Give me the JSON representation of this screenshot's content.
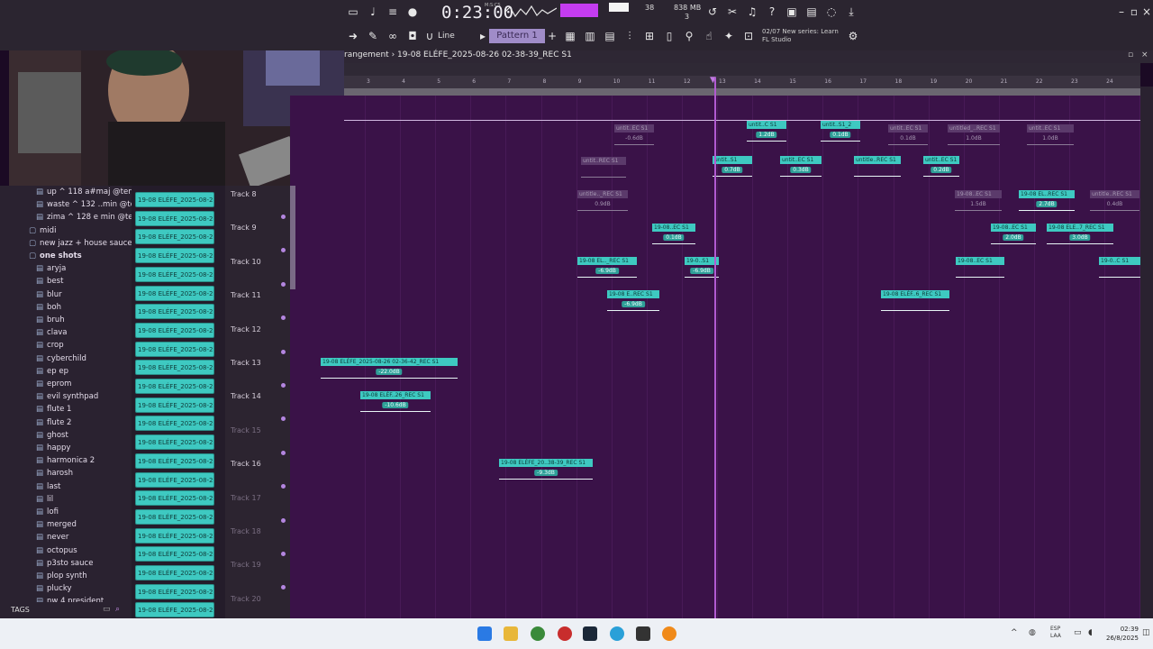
{
  "toolbar": {
    "time": "0:23:00",
    "time_label": "M:S:CS",
    "cpu": "38",
    "memory": "838 MB",
    "polyphony": "3",
    "snap": "Line",
    "pattern": "Pattern 1",
    "news_line1": "02/07  New series: Learn",
    "news_line2": "FL Studio"
  },
  "playlist": {
    "title": "rangement  ›  19-08 ELÉFE_2025-08-26 02-38-39_REC S1",
    "ruler_ticks": [
      "3",
      "4",
      "5",
      "6",
      "7",
      "8",
      "9",
      "10",
      "11",
      "12",
      "13",
      "14",
      "15",
      "16",
      "17",
      "18",
      "19",
      "20",
      "21",
      "22",
      "23",
      "24"
    ]
  },
  "browser": {
    "items": [
      {
        "label": "up ^ 118 a#maj @tengo",
        "type": "file"
      },
      {
        "label": "waste ^ 132 ..min @tengo",
        "type": "file"
      },
      {
        "label": "zima ^ 128 e min @tengo",
        "type": "file"
      },
      {
        "label": "midi",
        "type": "folder"
      },
      {
        "label": "new jazz + house sauce",
        "type": "folder"
      },
      {
        "label": "one shots",
        "type": "folder-open"
      },
      {
        "label": "aryja",
        "type": "file"
      },
      {
        "label": "best",
        "type": "file"
      },
      {
        "label": "blur",
        "type": "file"
      },
      {
        "label": "boh",
        "type": "file"
      },
      {
        "label": "bruh",
        "type": "file"
      },
      {
        "label": "clava",
        "type": "file"
      },
      {
        "label": "crop",
        "type": "file"
      },
      {
        "label": "cyberchild",
        "type": "file"
      },
      {
        "label": "ep ep",
        "type": "file"
      },
      {
        "label": "eprom",
        "type": "file"
      },
      {
        "label": "evil synthpad",
        "type": "file"
      },
      {
        "label": "flute 1",
        "type": "file"
      },
      {
        "label": "flute 2",
        "type": "file"
      },
      {
        "label": "ghost",
        "type": "file"
      },
      {
        "label": "happy",
        "type": "file"
      },
      {
        "label": "harmonica 2",
        "type": "file"
      },
      {
        "label": "harosh",
        "type": "file"
      },
      {
        "label": "last",
        "type": "file"
      },
      {
        "label": "lil",
        "type": "file"
      },
      {
        "label": "lofi",
        "type": "file"
      },
      {
        "label": "merged",
        "type": "file"
      },
      {
        "label": "never",
        "type": "file"
      },
      {
        "label": "octopus",
        "type": "file"
      },
      {
        "label": "p3sto sauce",
        "type": "file"
      },
      {
        "label": "plop synth",
        "type": "file"
      },
      {
        "label": "plucky",
        "type": "file"
      },
      {
        "label": "nw 4 president",
        "type": "file"
      }
    ],
    "tags_label": "TAGS"
  },
  "channels": {
    "label": "19-08 ELÉFE_2025-08-2..",
    "count": 23
  },
  "tracks": [
    {
      "label": "Track 8",
      "dim": false
    },
    {
      "label": "Track 9",
      "dim": false
    },
    {
      "label": "Track 10",
      "dim": false
    },
    {
      "label": "Track 11",
      "dim": false
    },
    {
      "label": "Track 12",
      "dim": false
    },
    {
      "label": "Track 13",
      "dim": false
    },
    {
      "label": "Track 14",
      "dim": false
    },
    {
      "label": "Track 15",
      "dim": true
    },
    {
      "label": "Track 16",
      "dim": false
    },
    {
      "label": "Track 17",
      "dim": true
    },
    {
      "label": "Track 18",
      "dim": true
    },
    {
      "label": "Track 19",
      "dim": true
    },
    {
      "label": "Track 20",
      "dim": true
    }
  ],
  "clips": [
    {
      "name": "untit..EC S1",
      "db": "-0.6dB",
      "dim": true
    },
    {
      "name": "untit..C S1",
      "db": "1.2dB",
      "dim": false
    },
    {
      "name": "untit..S1_2",
      "db": "0.1dB",
      "dim": false
    },
    {
      "name": "untit..EC S1",
      "db": "0.1dB",
      "dim": true
    },
    {
      "name": "untitled_..REC S1",
      "db": "1.0dB",
      "dim": true
    },
    {
      "name": "untit..EC S1",
      "db": "1.0dB",
      "dim": true
    },
    {
      "name": "untit..REC S1",
      "db": "",
      "dim": true
    },
    {
      "name": "untit..S1",
      "db": "0.7dB",
      "dim": false
    },
    {
      "name": "untit..EC S1",
      "db": "0.3dB",
      "dim": false
    },
    {
      "name": "untitle..REC S1",
      "db": "",
      "dim": false
    },
    {
      "name": "untit..EC S1",
      "db": "0.2dB",
      "dim": false
    },
    {
      "name": "untitle.._REC S1",
      "db": "0.9dB",
      "dim": true
    },
    {
      "name": "19-08..EC S1",
      "db": "1.5dB",
      "dim": true
    },
    {
      "name": "19-08 EL..REC S1",
      "db": "2.7dB",
      "dim": false
    },
    {
      "name": "untitle..REC S1",
      "db": "0.4dB",
      "dim": true
    },
    {
      "name": "19-08..EC S1",
      "db": "0.1dB",
      "dim": false
    },
    {
      "name": "19-08..EC S1",
      "db": "2.0dB",
      "dim": false
    },
    {
      "name": "19-08 ELE..7_REC S1",
      "db": "3.0dB",
      "dim": false
    },
    {
      "name": "19-08 EL.._REC S1",
      "db": "-6.9dB",
      "dim": false
    },
    {
      "name": "19-0..S1",
      "db": "-6.9dB",
      "dim": false
    },
    {
      "name": "19-08..EC S1",
      "db": "",
      "dim": false
    },
    {
      "name": "19-0..C S1",
      "db": "",
      "dim": false
    },
    {
      "name": "19-08 E..REC S1",
      "db": "-6.9dB",
      "dim": false
    },
    {
      "name": "19-08 ELÉF..6_REC S1",
      "db": "",
      "dim": false
    },
    {
      "name": "19-08 ELÉFE_2025-08-26 02-36-42_REC S1",
      "db": "-22.0dB",
      "dim": false
    },
    {
      "name": "19-08 ELÉF..26_REC S1",
      "db": "-10.6dB",
      "dim": false
    },
    {
      "name": "19-08 ELÉFE_20..38-39_REC S1",
      "db": "-9.3dB",
      "dim": false
    }
  ],
  "taskbar": {
    "lang_line1": "ESP",
    "lang_line2": "LAA",
    "time": "02:39",
    "date": "26/8/2025"
  }
}
